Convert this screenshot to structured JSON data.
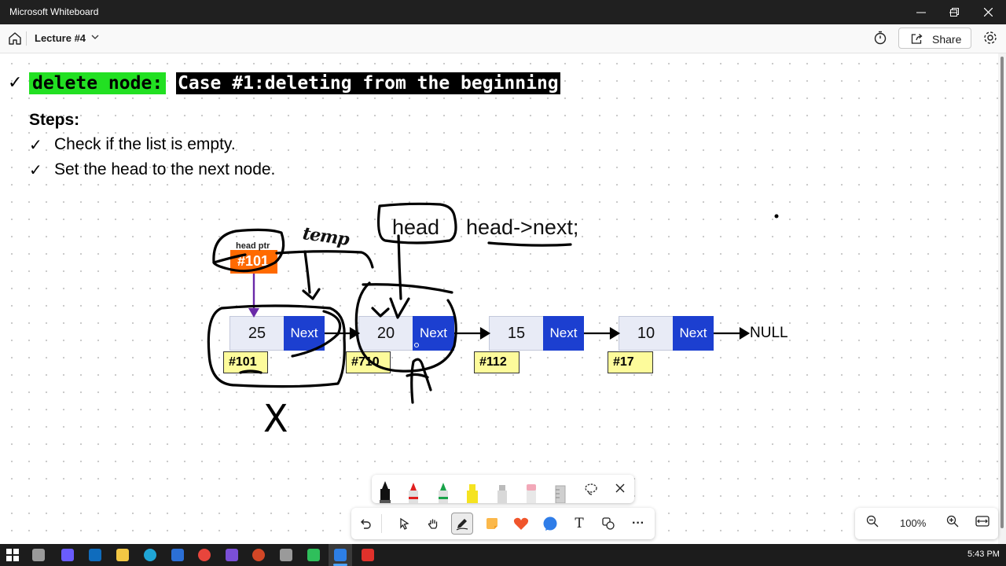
{
  "window": {
    "title": "Microsoft Whiteboard",
    "controls": [
      "minimize",
      "restore",
      "close"
    ]
  },
  "header": {
    "doc_title": "Lecture #4",
    "share_label": "Share",
    "icons": [
      "home-icon",
      "chevron-down-icon",
      "timer-icon",
      "share-icon",
      "gear-icon"
    ]
  },
  "slide": {
    "heading_green": "delete node: ",
    "heading_black": "Case #1:deleting from the beginning",
    "steps_title": "Steps:",
    "steps": [
      "Check if the list is empty.",
      "Set the head to the next node."
    ],
    "check_mark": "✓"
  },
  "diagram": {
    "head_ptr_label": "head ptr",
    "head_ptr_value": "#101",
    "nodes": [
      {
        "value": "25",
        "next": "Next",
        "address": "#101"
      },
      {
        "value": "20",
        "next": "Next",
        "address": "#710"
      },
      {
        "value": "15",
        "next": "Next",
        "address": "#112"
      },
      {
        "value": "10",
        "next": "Next",
        "address": "#17"
      }
    ],
    "null_label": "NULL"
  },
  "ink": {
    "head_word": "head",
    "code": "head->next;",
    "temp_word": "temp",
    "x_mark": "X"
  },
  "pen_tray": {
    "pens": [
      {
        "name": "black-pen",
        "color": "#111111"
      },
      {
        "name": "red-pen",
        "color": "#e02020"
      },
      {
        "name": "green-pen",
        "color": "#1aa34a"
      },
      {
        "name": "yellow-highlighter",
        "color": "#f5e320"
      },
      {
        "name": "eraser-pen",
        "color": "#d9d9d9"
      },
      {
        "name": "pink-eraser",
        "color": "#f2a8b8"
      },
      {
        "name": "ruler",
        "color": "#cccccc"
      }
    ]
  },
  "toolbar": {
    "tools": [
      "undo-icon",
      "select-icon",
      "hand-icon",
      "pen-icon",
      "sticky-note-icon",
      "reaction-icon",
      "shape-icon",
      "text-icon",
      "copy-icon",
      "more-icon"
    ],
    "text_tool_label": "T",
    "more_label": "···"
  },
  "zoom": {
    "value": "100%"
  },
  "taskbar": {
    "time": "5:43 PM",
    "apps": [
      {
        "name": "windows-start",
        "color": "#ffffff"
      },
      {
        "name": "task-view",
        "color": "#bbbbbb"
      },
      {
        "name": "copilot",
        "color": "#6a5cff"
      },
      {
        "name": "outlook",
        "color": "#0f6cbd"
      },
      {
        "name": "file-explorer",
        "color": "#f2c744"
      },
      {
        "name": "edge",
        "color": "#1fa5d6"
      },
      {
        "name": "store",
        "color": "#2b6fd6"
      },
      {
        "name": "chrome",
        "color": "#e8453c"
      },
      {
        "name": "visual-studio",
        "color": "#7b4fd6"
      },
      {
        "name": "powerpoint",
        "color": "#d24726"
      },
      {
        "name": "snipping-tool",
        "color": "#9a9a9a"
      },
      {
        "name": "camtasia",
        "color": "#2fbf5b"
      },
      {
        "name": "whiteboard",
        "color": "#2d7fe6"
      },
      {
        "name": "recorder",
        "color": "#e0312b"
      }
    ]
  }
}
